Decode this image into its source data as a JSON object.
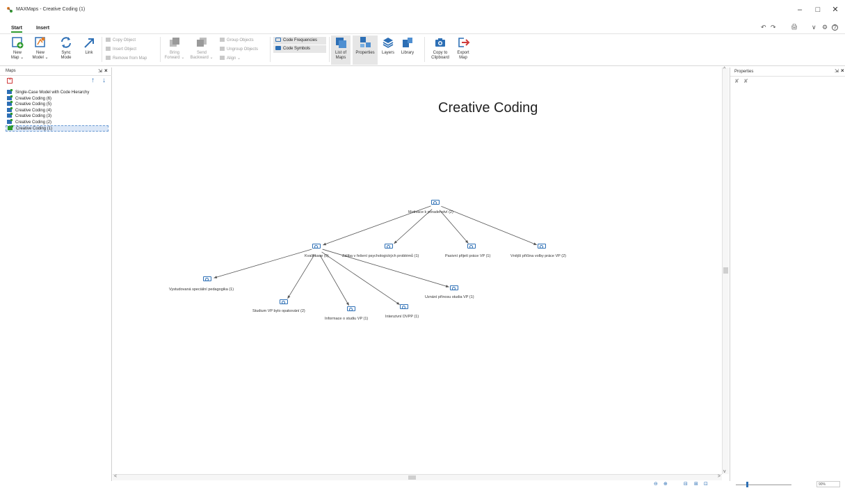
{
  "window": {
    "title": "MAXMaps - Creative Coding (1)",
    "minimize": "–",
    "maximize": "□",
    "close": "✕"
  },
  "tabs": [
    {
      "label": "Start",
      "active": true
    },
    {
      "label": "Insert",
      "active": false
    }
  ],
  "quick_access": {
    "undo": "↶",
    "redo": "↷",
    "print": "🖨",
    "collapse": "∨",
    "settings": "⚙",
    "help": "?"
  },
  "ribbon": {
    "new_map": {
      "label1": "New",
      "label2": "Map ⌄"
    },
    "new_model": {
      "label1": "New",
      "label2": "Model ⌄"
    },
    "sync_mode": {
      "label1": "Sync",
      "label2": "Mode"
    },
    "link": {
      "label1": "Link",
      "label2": ""
    },
    "copy_object": "Copy Object",
    "insert_object": "Insert Object",
    "remove_from_map": "Remove from Map",
    "bring_forward": {
      "label1": "Bring",
      "label2": "Forward ⌄"
    },
    "send_backward": {
      "label1": "Send",
      "label2": "Backward ⌄"
    },
    "group_objects": "Group Objects",
    "ungroup_objects": "Ungroup Objects",
    "align": "Align ⌄",
    "code_frequencies": "Code Frequencies",
    "code_symbols": "Code Symbols",
    "list_of_maps": {
      "label1": "List of",
      "label2": "Maps"
    },
    "properties": {
      "label1": "Properties",
      "label2": ""
    },
    "layers": {
      "label1": "Layers",
      "label2": ""
    },
    "library": {
      "label1": "Library",
      "label2": ""
    },
    "copy_to_clipboard": {
      "label1": "Copy to",
      "label2": "Clipboard"
    },
    "export_map": {
      "label1": "Export",
      "label2": "Map"
    }
  },
  "maps_panel": {
    "title": "Maps",
    "pin": "⇲",
    "close": "×",
    "up": "↑",
    "down": "↓",
    "items": [
      {
        "label": "Single-Case Model with Code Hierarchy",
        "selected": false
      },
      {
        "label": "Creative Coding (6)",
        "selected": false
      },
      {
        "label": "Creative Coding (5)",
        "selected": false
      },
      {
        "label": "Creative Coding (4)",
        "selected": false
      },
      {
        "label": "Creative Coding (3)",
        "selected": false
      },
      {
        "label": "Creative Coding (2)",
        "selected": false
      },
      {
        "label": "Creative Coding (1)",
        "selected": true
      }
    ]
  },
  "canvas": {
    "title": "Creative Coding",
    "nodes": [
      {
        "id": "motivace",
        "label": "Motivace k poradenství (2)"
      },
      {
        "id": "kvalifikace",
        "label": "Kvalifikace (0)"
      },
      {
        "id": "zaliba",
        "label": "Záliba v řešení psychologických problémů (1)"
      },
      {
        "id": "pasivni",
        "label": "Pasivní přijetí práce VP (1)"
      },
      {
        "id": "vnejsi",
        "label": "Vnější příčina volby práce VP (2)"
      },
      {
        "id": "vystudovana",
        "label": "Vystudovaná speciální pedagogika (1)"
      },
      {
        "id": "studium",
        "label": "Studium VP bylo opakování (2)"
      },
      {
        "id": "informace",
        "label": "Informace o studiu VP (1)"
      },
      {
        "id": "intenzivni",
        "label": "Intenzivní DVPP (1)"
      },
      {
        "id": "uznani",
        "label": "Uznání přínosu studia VP (1)"
      }
    ],
    "links": [
      [
        "motivace",
        "kvalifikace"
      ],
      [
        "motivace",
        "zaliba"
      ],
      [
        "motivace",
        "pasivni"
      ],
      [
        "motivace",
        "vnejsi"
      ],
      [
        "kvalifikace",
        "vystudovana"
      ],
      [
        "kvalifikace",
        "studium"
      ],
      [
        "kvalifikace",
        "informace"
      ],
      [
        "kvalifikace",
        "intenzivni"
      ],
      [
        "kvalifikace",
        "uznani"
      ]
    ]
  },
  "scrollbars": {
    "left": "<",
    "right": ">",
    "up": "^",
    "down": "v"
  },
  "properties_panel": {
    "title": "Properties",
    "pin": "⇲",
    "close": "×",
    "tool1": "✘",
    "tool2": "✘"
  },
  "statusbar": {
    "zoom_out": "⊖",
    "zoom_in": "⊕",
    "fit": "⊟",
    "view1": "⊞",
    "view2": "⊡",
    "zoom_value": "90%",
    "zoom_level": 0.18
  }
}
